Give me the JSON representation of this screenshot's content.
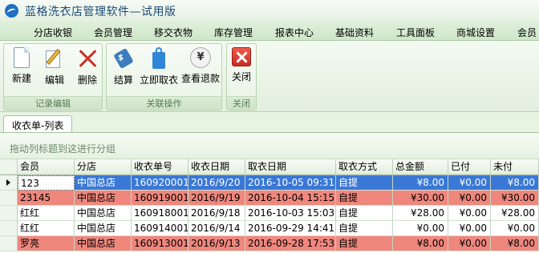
{
  "window": {
    "title": "蓝格洗衣店管理软件—试用版"
  },
  "menu": [
    "分店收银",
    "会员管理",
    "移交衣物",
    "库存管理",
    "报表中心",
    "基础资料",
    "工具面板",
    "商城设置",
    "会员"
  ],
  "ribbon": {
    "groups": [
      {
        "label": "记录编辑",
        "buttons": [
          "新建",
          "编辑",
          "删除"
        ]
      },
      {
        "label": "关联操作",
        "buttons": [
          "结算",
          "立即取衣",
          "查看退款"
        ]
      },
      {
        "label": "关闭",
        "buttons": [
          "关闭"
        ]
      }
    ],
    "icons": [
      "new-document-icon",
      "edit-icon",
      "delete-icon",
      "checkout-tag-icon",
      "pickup-bag-icon",
      "yen-refund-icon",
      "close-icon"
    ]
  },
  "document_tab": "收衣单-列表",
  "group_hint": "拖动列标题到这进行分组",
  "grid": {
    "columns": [
      "会员",
      "分店",
      "收衣单号",
      "收衣日期",
      "取衣日期",
      "取衣方式",
      "总金额",
      "已付",
      "未付"
    ],
    "rows": [
      {
        "cells": [
          "123",
          "中国总店",
          "160920001",
          "2016/9/20",
          "2016-10-05 09:31",
          "自提",
          "¥8.00",
          "¥0.00",
          "¥8.00"
        ],
        "state": "selected"
      },
      {
        "cells": [
          "23145",
          "中国总店",
          "160919001",
          "2016/9/19",
          "2016-10-04 15:15",
          "自提",
          "¥30.00",
          "¥0.00",
          "¥30.00"
        ],
        "state": "unpaid"
      },
      {
        "cells": [
          "红红",
          "中国总店",
          "160918001",
          "2016/9/18",
          "2016-10-03 15:03",
          "自提",
          "¥28.00",
          "¥0.00",
          "¥28.00"
        ],
        "state": "normal"
      },
      {
        "cells": [
          "红红",
          "中国总店",
          "160914001",
          "2016/9/14",
          "2016-09-29 14:41",
          "自提",
          "¥0.00",
          "¥0.00",
          "¥0.00"
        ],
        "state": "normal"
      },
      {
        "cells": [
          "罗亮",
          "中国总店",
          "160913001",
          "2016/9/13",
          "2016-09-28 17:53",
          "自提",
          "¥8.00",
          "¥0.00",
          "¥8.00"
        ],
        "state": "unpaid"
      }
    ]
  },
  "colors": {
    "selected_row": "#3a78d6",
    "unpaid_row": "#f0877d",
    "accent": "#1f6fc4"
  }
}
